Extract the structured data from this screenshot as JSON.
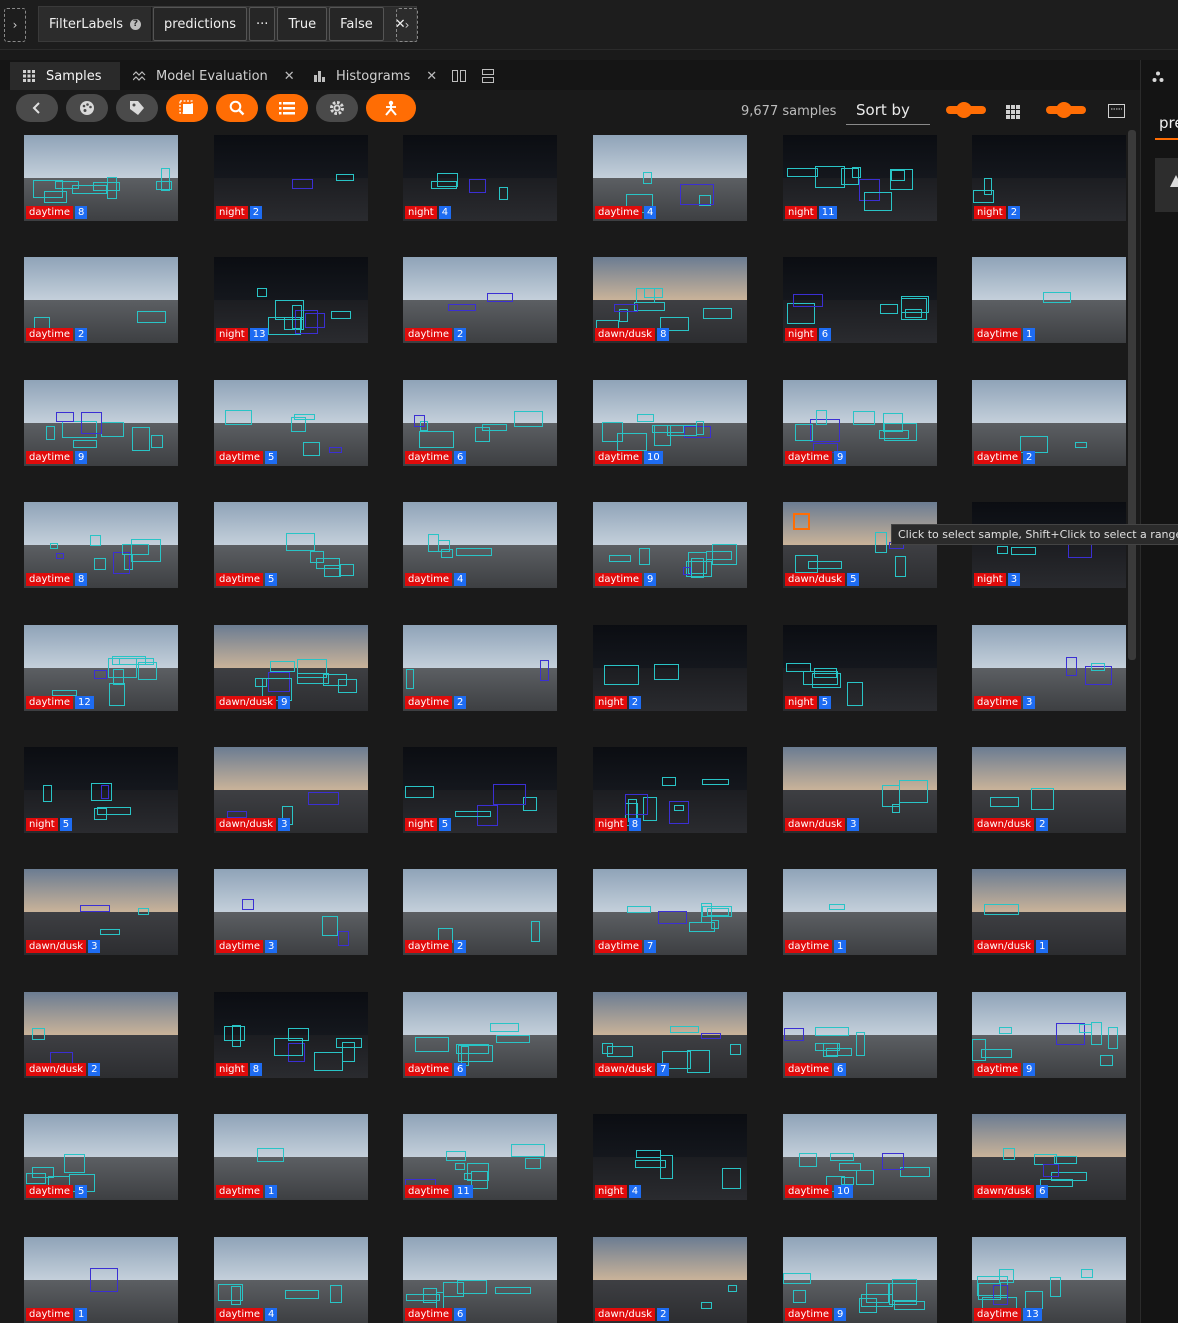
{
  "view_bar": {
    "stage": {
      "filter_label": "FilterLabels",
      "help_icon": "?",
      "field": "predictions",
      "more": "···",
      "true_label": "True",
      "false_label": "False",
      "close": "✕"
    },
    "left_expander_icon": "chevron-right-icon",
    "right_expander_icon": "chevron-right-icon"
  },
  "tabs": [
    {
      "label": "Samples",
      "icon": "grid-icon",
      "active": true
    },
    {
      "label": "Model Evaluation",
      "icon": "chart-icon",
      "closable": true
    },
    {
      "label": "Histograms",
      "icon": "bar-chart-icon",
      "closable": true
    }
  ],
  "right_panel": {
    "label_fragment": "pre"
  },
  "actions": {
    "buttons": [
      "back-icon",
      "palette-icon",
      "tag-icon",
      "select-icon",
      "search-icon",
      "list-icon",
      "gear-icon",
      "person-icon"
    ],
    "sample_count": "9,677 samples",
    "sort_by": "Sort by"
  },
  "tooltip": "Click to select sample, Shift+Click to select a range",
  "samples": [
    [
      {
        "tod": "daytime",
        "n": "8"
      },
      {
        "tod": "night",
        "n": "2"
      },
      {
        "tod": "night",
        "n": "4"
      },
      {
        "tod": "daytime",
        "n": "4"
      },
      {
        "tod": "night",
        "n": "11"
      },
      {
        "tod": "night",
        "n": "2"
      }
    ],
    [
      {
        "tod": "daytime",
        "n": "2"
      },
      {
        "tod": "night",
        "n": "13"
      },
      {
        "tod": "daytime",
        "n": "2"
      },
      {
        "tod": "dawn/dusk",
        "n": "8"
      },
      {
        "tod": "night",
        "n": "6"
      },
      {
        "tod": "daytime",
        "n": "1"
      }
    ],
    [
      {
        "tod": "daytime",
        "n": "9"
      },
      {
        "tod": "daytime",
        "n": "5"
      },
      {
        "tod": "daytime",
        "n": "6"
      },
      {
        "tod": "daytime",
        "n": "10"
      },
      {
        "tod": "daytime",
        "n": "9"
      },
      {
        "tod": "daytime",
        "n": "2"
      }
    ],
    [
      {
        "tod": "daytime",
        "n": "8"
      },
      {
        "tod": "daytime",
        "n": "5"
      },
      {
        "tod": "daytime",
        "n": "4"
      },
      {
        "tod": "daytime",
        "n": "9"
      },
      {
        "tod": "dawn/dusk",
        "n": "5"
      },
      {
        "tod": "night",
        "n": "3"
      }
    ],
    [
      {
        "tod": "daytime",
        "n": "12"
      },
      {
        "tod": "dawn/dusk",
        "n": "9"
      },
      {
        "tod": "daytime",
        "n": "2"
      },
      {
        "tod": "night",
        "n": "2"
      },
      {
        "tod": "night",
        "n": "5"
      },
      {
        "tod": "daytime",
        "n": "3"
      }
    ],
    [
      {
        "tod": "night",
        "n": "5"
      },
      {
        "tod": "dawn/dusk",
        "n": "3"
      },
      {
        "tod": "night",
        "n": "5"
      },
      {
        "tod": "night",
        "n": "8"
      },
      {
        "tod": "dawn/dusk",
        "n": "3"
      },
      {
        "tod": "dawn/dusk",
        "n": "2"
      }
    ],
    [
      {
        "tod": "dawn/dusk",
        "n": "3"
      },
      {
        "tod": "daytime",
        "n": "3"
      },
      {
        "tod": "daytime",
        "n": "2"
      },
      {
        "tod": "daytime",
        "n": "7"
      },
      {
        "tod": "daytime",
        "n": "1"
      },
      {
        "tod": "dawn/dusk",
        "n": "1"
      }
    ],
    [
      {
        "tod": "dawn/dusk",
        "n": "2"
      },
      {
        "tod": "night",
        "n": "8"
      },
      {
        "tod": "daytime",
        "n": "6"
      },
      {
        "tod": "dawn/dusk",
        "n": "7"
      },
      {
        "tod": "daytime",
        "n": "6"
      },
      {
        "tod": "daytime",
        "n": "9"
      }
    ],
    [
      {
        "tod": "daytime",
        "n": "5"
      },
      {
        "tod": "daytime",
        "n": "1"
      },
      {
        "tod": "daytime",
        "n": "11"
      },
      {
        "tod": "night",
        "n": "4"
      },
      {
        "tod": "daytime",
        "n": "10"
      },
      {
        "tod": "dawn/dusk",
        "n": "6"
      }
    ],
    [
      {
        "tod": "daytime",
        "n": "1"
      },
      {
        "tod": "daytime",
        "n": "4"
      },
      {
        "tod": "daytime",
        "n": "6"
      },
      {
        "tod": "dawn/dusk",
        "n": "2"
      },
      {
        "tod": "daytime",
        "n": "9"
      },
      {
        "tod": "daytime",
        "n": "13"
      }
    ]
  ],
  "colors": {
    "accent": "#ff6d04",
    "tod_badge": "#e00b0b",
    "count_badge": "#1e6cf2",
    "bbox": "#29c4c6"
  }
}
